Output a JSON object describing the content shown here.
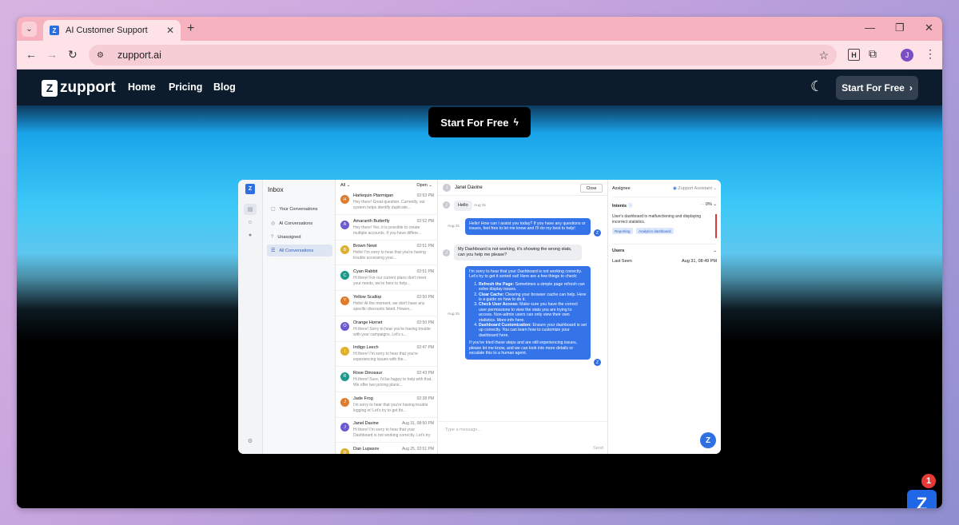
{
  "browser": {
    "tab_title": "AI Customer Support",
    "url": "zupport.ai",
    "profile_initial": "J",
    "ext_letter": "H"
  },
  "site": {
    "logo_text": "zupport",
    "nav": [
      "Home",
      "Pricing",
      "Blog"
    ],
    "cta_top": "Start For Free",
    "cta_main": "Start For Free"
  },
  "app": {
    "inbox_title": "Inbox",
    "inbox_items": [
      "Your Conversations",
      "AI Conversations",
      "Unassigned",
      "All Conversations"
    ],
    "filter_all": "All",
    "filter_open": "Open",
    "conversations": [
      {
        "initial": "H",
        "name": "Harlequin Ptarmigan",
        "time": "02:53 PM",
        "preview": "Hey there! Great question. Currently, our system helps identify duplicate...",
        "color": "#e07b2c"
      },
      {
        "initial": "A",
        "name": "Amaranth Butterfly",
        "time": "02:52 PM",
        "preview": "Hey there! Yes, it is possible to create multiple accounts. If you have differe...",
        "color": "#6a5bd1"
      },
      {
        "initial": "B",
        "name": "Brown Newt",
        "time": "02:51 PM",
        "preview": "Hello! I'm sorry to hear that you're having trouble accessing your...",
        "color": "#e0b02c"
      },
      {
        "initial": "C",
        "name": "Cyan Rabbit",
        "time": "02:51 PM",
        "preview": "Hi there! For our current plans don't meet your needs, we're here to help...",
        "color": "#1a9a8a"
      },
      {
        "initial": "Y",
        "name": "Yellow Scallop",
        "time": "02:50 PM",
        "preview": "Hello! At the moment, we don't have any specific discounts listed. Howev...",
        "color": "#e07b2c"
      },
      {
        "initial": "O",
        "name": "Orange Hornet",
        "time": "02:50 PM",
        "preview": "Hi there! Sorry to hear you're having trouble with your campaigns. Let's s...",
        "color": "#6a5bd1"
      },
      {
        "initial": "I",
        "name": "Indigo Leech",
        "time": "02:47 PM",
        "preview": "Hi there! I'm sorry to hear that you're experiencing issues with the...",
        "color": "#e0b02c"
      },
      {
        "initial": "R",
        "name": "Rose Dinosaur",
        "time": "02:43 PM",
        "preview": "Hi there! Sure, I'd be happy to help with that. We offer two pricing plans...",
        "color": "#1a9a8a"
      },
      {
        "initial": "J",
        "name": "Jade Frog",
        "time": "02:38 PM",
        "preview": "I'm sorry to hear that you're having trouble logging in! Let's try to get thi...",
        "color": "#e07b2c"
      },
      {
        "initial": "J",
        "name": "Janel Davine",
        "time": "Aug 31, 08:50 PM",
        "preview": "Hi there! I'm sorry to hear that your Dashboard is not working correctly. Let's try to get i...",
        "color": "#6a5bd1"
      },
      {
        "initial": "D",
        "name": "Dan Lupasov",
        "time": "Aug 25, 02:51 PM",
        "preview": "",
        "color": "#e0b02c"
      }
    ],
    "chat": {
      "contact_initial": "J",
      "contact_name": "Janel Davine",
      "close_label": "Close",
      "msg_hello": "Hello",
      "msg_hello_time": "Aug 31",
      "bot_greeting": "Hello! How can I assist you today? If you have any questions or issues, feel free to let me know and I'll do my best to help!",
      "bot_greeting_time": "Aug 31",
      "user_msg2": "My Dashboard is not working, it's showing the wrong stats, can you help me please?",
      "user_msg2_time": "Aug 31",
      "bot_reply_intro": "I'm sorry to hear that your Dashboard is not working correctly. Let's try to get it sorted out! Here are a few things to check:",
      "bot_reply_items": [
        {
          "title": "Refresh the Page:",
          "text": "Sometimes a simple page refresh can solve display issues."
        },
        {
          "title": "Clear Cache:",
          "text": "Clearing your browser cache can help. Here is a guide on how to do it."
        },
        {
          "title": "Check User Access:",
          "text": "Make sure you have the correct user permissions to view the stats you are trying to access. Non-admin users can only view their own statistics. More info here."
        },
        {
          "title": "Dashboard Customization:",
          "text": "Ensure your dashboard is set up correctly. You can learn how to customize your dashboard here."
        }
      ],
      "bot_reply_outro": "If you've tried these steps and are still experiencing issues, please let me know, and we can look into more details or escalate this to a human agent.",
      "bot_reply_time": "Aug 31",
      "input_placeholder": "Type a message...",
      "send_label": "Send"
    },
    "details": {
      "assignee_label": "Assignee",
      "assignee_value": "Zupport Assistant",
      "intents_label": "Intents",
      "intents_percent": "0%",
      "intent_text": "User's dashboard is malfunctioning and displaying incorrect statistics.",
      "tags": [
        "Reporting",
        "Analytics dashboard"
      ],
      "users_label": "Users",
      "last_seen_label": "Last Seen",
      "last_seen_value": "Aug 31, 08:49 PM"
    }
  },
  "support_widget": {
    "badge_count": "1"
  }
}
